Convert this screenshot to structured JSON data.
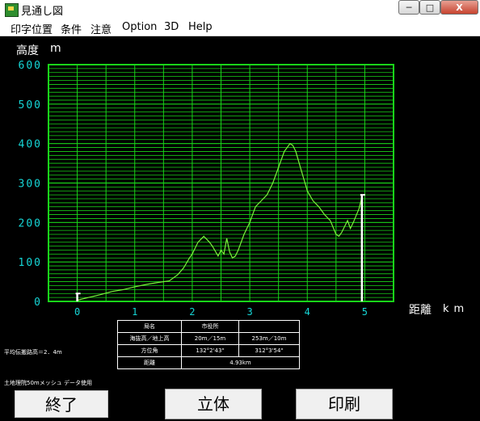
{
  "window": {
    "title": "見通し図",
    "min_label": "─",
    "max_label": "□",
    "close_label": "X"
  },
  "menu": [
    "印字位置",
    "条件",
    "注意",
    "Option",
    "3D",
    "Help"
  ],
  "axes": {
    "y_title": "高度",
    "y_unit": "m",
    "x_title": "距離",
    "x_unit": "km"
  },
  "chart_data": {
    "type": "area",
    "x_label": "距離 km",
    "y_label": "高度 m",
    "xlim": [
      -0.5,
      5.5
    ],
    "ylim": [
      0,
      600
    ],
    "x_ticks": [
      "0",
      "1",
      "2",
      "3",
      "4",
      "5"
    ],
    "y_ticks": [
      "0",
      "100",
      "200",
      "300",
      "400",
      "500",
      "600"
    ],
    "grid": true,
    "line_color": "#7cf03c",
    "grid_color": "#19d419",
    "profile": {
      "x": [
        0,
        0.2,
        0.4,
        0.6,
        0.8,
        1.0,
        1.2,
        1.4,
        1.6,
        1.75,
        1.85,
        1.95,
        2.0,
        2.1,
        2.2,
        2.3,
        2.35,
        2.45,
        2.5,
        2.55,
        2.6,
        2.65,
        2.7,
        2.75,
        2.8,
        2.9,
        3.0,
        3.05,
        3.1,
        3.2,
        3.3,
        3.4,
        3.5,
        3.6,
        3.7,
        3.75,
        3.8,
        3.9,
        4.0,
        4.1,
        4.2,
        4.3,
        4.4,
        4.5,
        4.55,
        4.6,
        4.7,
        4.75,
        4.8,
        4.9,
        4.95
      ],
      "y": [
        3,
        10,
        17,
        25,
        30,
        37,
        43,
        48,
        52,
        68,
        85,
        110,
        120,
        150,
        165,
        150,
        140,
        115,
        130,
        120,
        160,
        125,
        110,
        115,
        130,
        170,
        200,
        220,
        240,
        255,
        270,
        300,
        340,
        380,
        400,
        395,
        380,
        330,
        280,
        255,
        240,
        220,
        205,
        170,
        165,
        175,
        205,
        185,
        200,
        235,
        265
      ]
    },
    "markers": [
      {
        "x": 0,
        "height": 20
      },
      {
        "x": 4.95,
        "height": 270
      }
    ]
  },
  "info_table": {
    "header": [
      "局名",
      "市役所",
      ""
    ],
    "rows": [
      [
        "海抜高／地上高",
        "20m／15m",
        "253m／10m"
      ],
      [
        "方位角",
        "132°2'43\"",
        "312°3'54\""
      ],
      [
        "距離",
        "4.93km",
        ""
      ]
    ]
  },
  "notes": {
    "average_height": "平均伝搬路高＝2．4m",
    "source": "土地理院50mメッシュ データ使用"
  },
  "buttons": {
    "quit": "終了",
    "three_d": "立体",
    "print": "印刷"
  }
}
